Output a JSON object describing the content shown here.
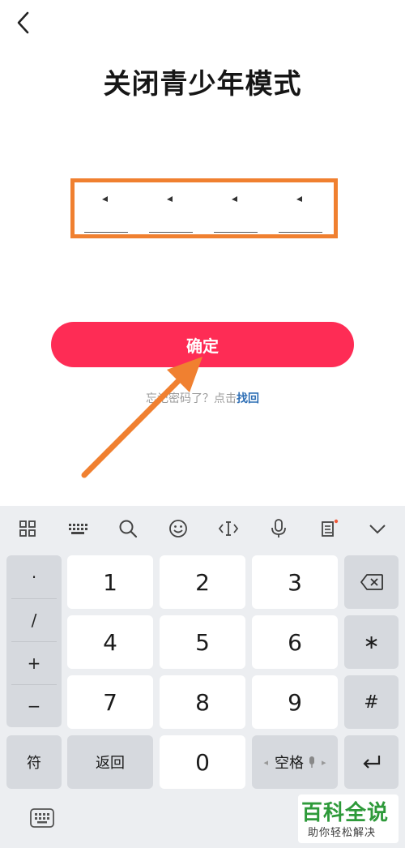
{
  "page": {
    "title": "关闭青少年模式"
  },
  "pin": {
    "slots": 4,
    "entered": 4
  },
  "confirm": {
    "label": "确定"
  },
  "forgot": {
    "text": "忘记密码了？点击",
    "link": "找回"
  },
  "colors": {
    "accent": "#fe2c55",
    "highlight_box": "#f08030",
    "link": "#2f6fb5"
  },
  "keyboard": {
    "toolbar": [
      "grid-icon",
      "keyboard-layout-icon",
      "search-icon",
      "emoji-icon",
      "cursor-icon",
      "microphone-icon",
      "clipboard-icon",
      "collapse-chevron-icon"
    ],
    "side_keys": [
      "·",
      "/",
      "+",
      "−"
    ],
    "digits": [
      "1",
      "2",
      "3",
      "4",
      "5",
      "6",
      "7",
      "8",
      "9",
      "0"
    ],
    "right_keys": {
      "star": "∗",
      "hash": "#"
    },
    "bottom": {
      "symbols": "符",
      "back": "返回",
      "space": "空格"
    }
  },
  "watermark": {
    "top": "百科全说",
    "bottom": "助你轻松解决"
  }
}
